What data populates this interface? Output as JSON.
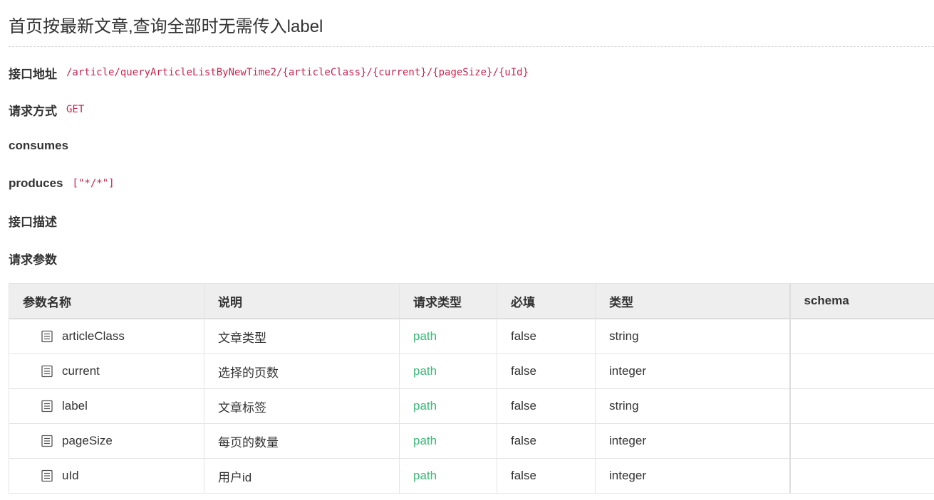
{
  "title": "首页按最新文章,查询全部时无需传入label",
  "fields": {
    "address": {
      "label": "接口地址",
      "value": "/article/queryArticleListByNewTime2/{articleClass}/{current}/{pageSize}/{uId}"
    },
    "method": {
      "label": "请求方式",
      "value": "GET"
    },
    "consumes": {
      "label": "consumes",
      "value": ""
    },
    "produces": {
      "label": "produces",
      "value": "[\"*/*\"]"
    },
    "description": {
      "label": "接口描述",
      "value": ""
    },
    "params_heading": {
      "label": "请求参数"
    }
  },
  "table": {
    "headers": [
      "参数名称",
      "说明",
      "请求类型",
      "必填",
      "类型",
      "schema"
    ],
    "rows": [
      {
        "name": "articleClass",
        "desc": "文章类型",
        "in": "path",
        "required": "false",
        "type": "string",
        "schema": ""
      },
      {
        "name": "current",
        "desc": "选择的页数",
        "in": "path",
        "required": "false",
        "type": "integer",
        "schema": ""
      },
      {
        "name": "label",
        "desc": "文章标签",
        "in": "path",
        "required": "false",
        "type": "string",
        "schema": ""
      },
      {
        "name": "pageSize",
        "desc": "每页的数量",
        "in": "path",
        "required": "false",
        "type": "integer",
        "schema": ""
      },
      {
        "name": "uId",
        "desc": "用户id",
        "in": "path",
        "required": "false",
        "type": "integer",
        "schema": ""
      }
    ],
    "row_icon": "document-list-icon"
  },
  "colors": {
    "code": "#c7254e",
    "path": "#3cb878",
    "header_bg": "#eeeeee"
  }
}
